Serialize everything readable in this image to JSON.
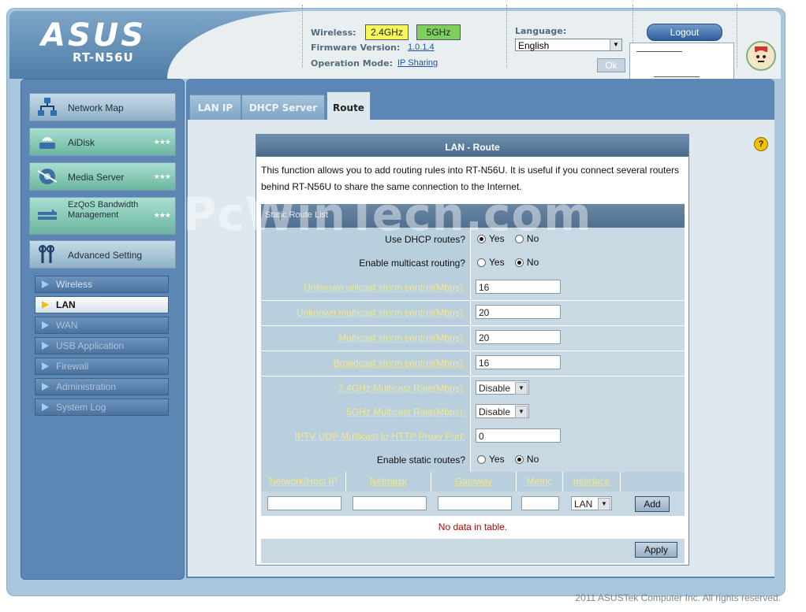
{
  "brand": {
    "logo": "ASUS",
    "model": "RT-N56U"
  },
  "header": {
    "wireless_label": "Wireless:",
    "band_24": "2.4GHz",
    "band_5": "5GHz",
    "firmware_label": "Firmware Version:",
    "firmware_value": "1.0.1.4",
    "opmode_label": "Operation Mode:",
    "opmode_value": "IP Sharing",
    "language_label": "Language:",
    "language_value": "English",
    "ok_label": "Ok",
    "logout_label": "Logout"
  },
  "sidebar": {
    "main": [
      {
        "label": "Network Map"
      },
      {
        "label": "AiDisk"
      },
      {
        "label": "Media Server"
      },
      {
        "label": "EzQoS Bandwidth Management"
      },
      {
        "label": "Advanced Setting"
      }
    ],
    "sub": [
      {
        "label": "Wireless"
      },
      {
        "label": "LAN"
      },
      {
        "label": "WAN"
      },
      {
        "label": "USB Application"
      },
      {
        "label": "Firewall"
      },
      {
        "label": "Administration"
      },
      {
        "label": "System Log"
      }
    ]
  },
  "tabs": [
    "LAN IP",
    "DHCP Server",
    "Route"
  ],
  "panel": {
    "title": "LAN - Route",
    "description": "This function allows you to add routing rules into RT-N56U. It is useful if you connect several routers behind RT-N56U to share the same connection to the Internet.",
    "section": "Static Route List",
    "yes": "Yes",
    "no": "No",
    "rows": {
      "dhcp_routes": "Use DHCP routes?",
      "multicast_routing": "Enable multicast routing?",
      "unicast_storm": "Unknown unicast storm control(Mbps):",
      "unicast_storm_value": "16",
      "unknown_multicast_storm": "Unknown multicast storm control(Mbps):",
      "unknown_multicast_storm_value": "20",
      "multicast_storm": "Multicast storm control(Mbps):",
      "multicast_storm_value": "20",
      "broadcast_storm": "Broadcast storm control(Mbps):",
      "broadcast_storm_value": "16",
      "rate_24": "2.4GHz Multicast Rate(Mbps):",
      "rate_24_value": "Disable",
      "rate_5": "5GHz Multicast Rate(Mbps):",
      "rate_5_value": "Disable",
      "iptv_port": "IPTV UDP Multicast to HTTP Proxy Port:",
      "iptv_port_value": "0",
      "static_routes": "Enable static routes?"
    },
    "columns": [
      "Network/Host IP",
      "Netmask",
      "Gateway",
      "Metric",
      "Interface"
    ],
    "interface_value": "LAN",
    "add_label": "Add",
    "no_data": "No data in table.",
    "apply_label": "Apply"
  },
  "watermark": "PcWinTech.com",
  "footer": "2011 ASUSTek Computer Inc. All rights reserved."
}
